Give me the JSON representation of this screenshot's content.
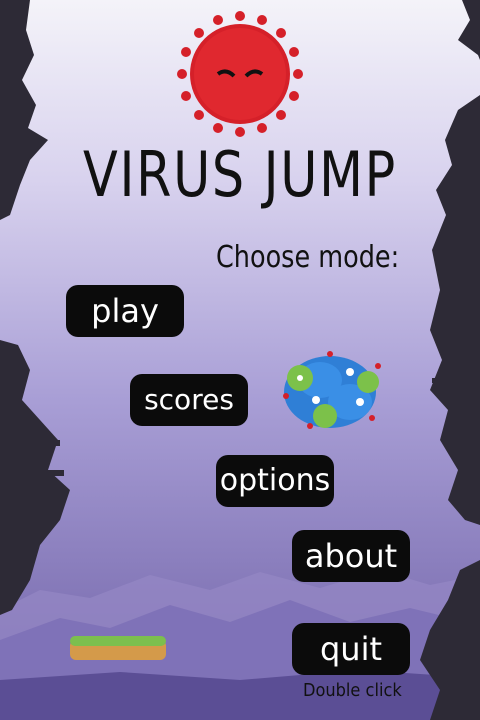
{
  "game": {
    "title": "VIRUS JUMP",
    "mode_prompt": "Choose mode:",
    "hint": "Double click"
  },
  "menu": {
    "play": "play",
    "scores": "scores",
    "options": "options",
    "about": "about",
    "quit": "quit"
  },
  "colors": {
    "sky_top": "#f2f1f8",
    "sky_mid": "#b6acdc",
    "sky_bottom": "#6f62a8",
    "button_bg": "#0b0b0b",
    "virus_red": "#d52029"
  }
}
